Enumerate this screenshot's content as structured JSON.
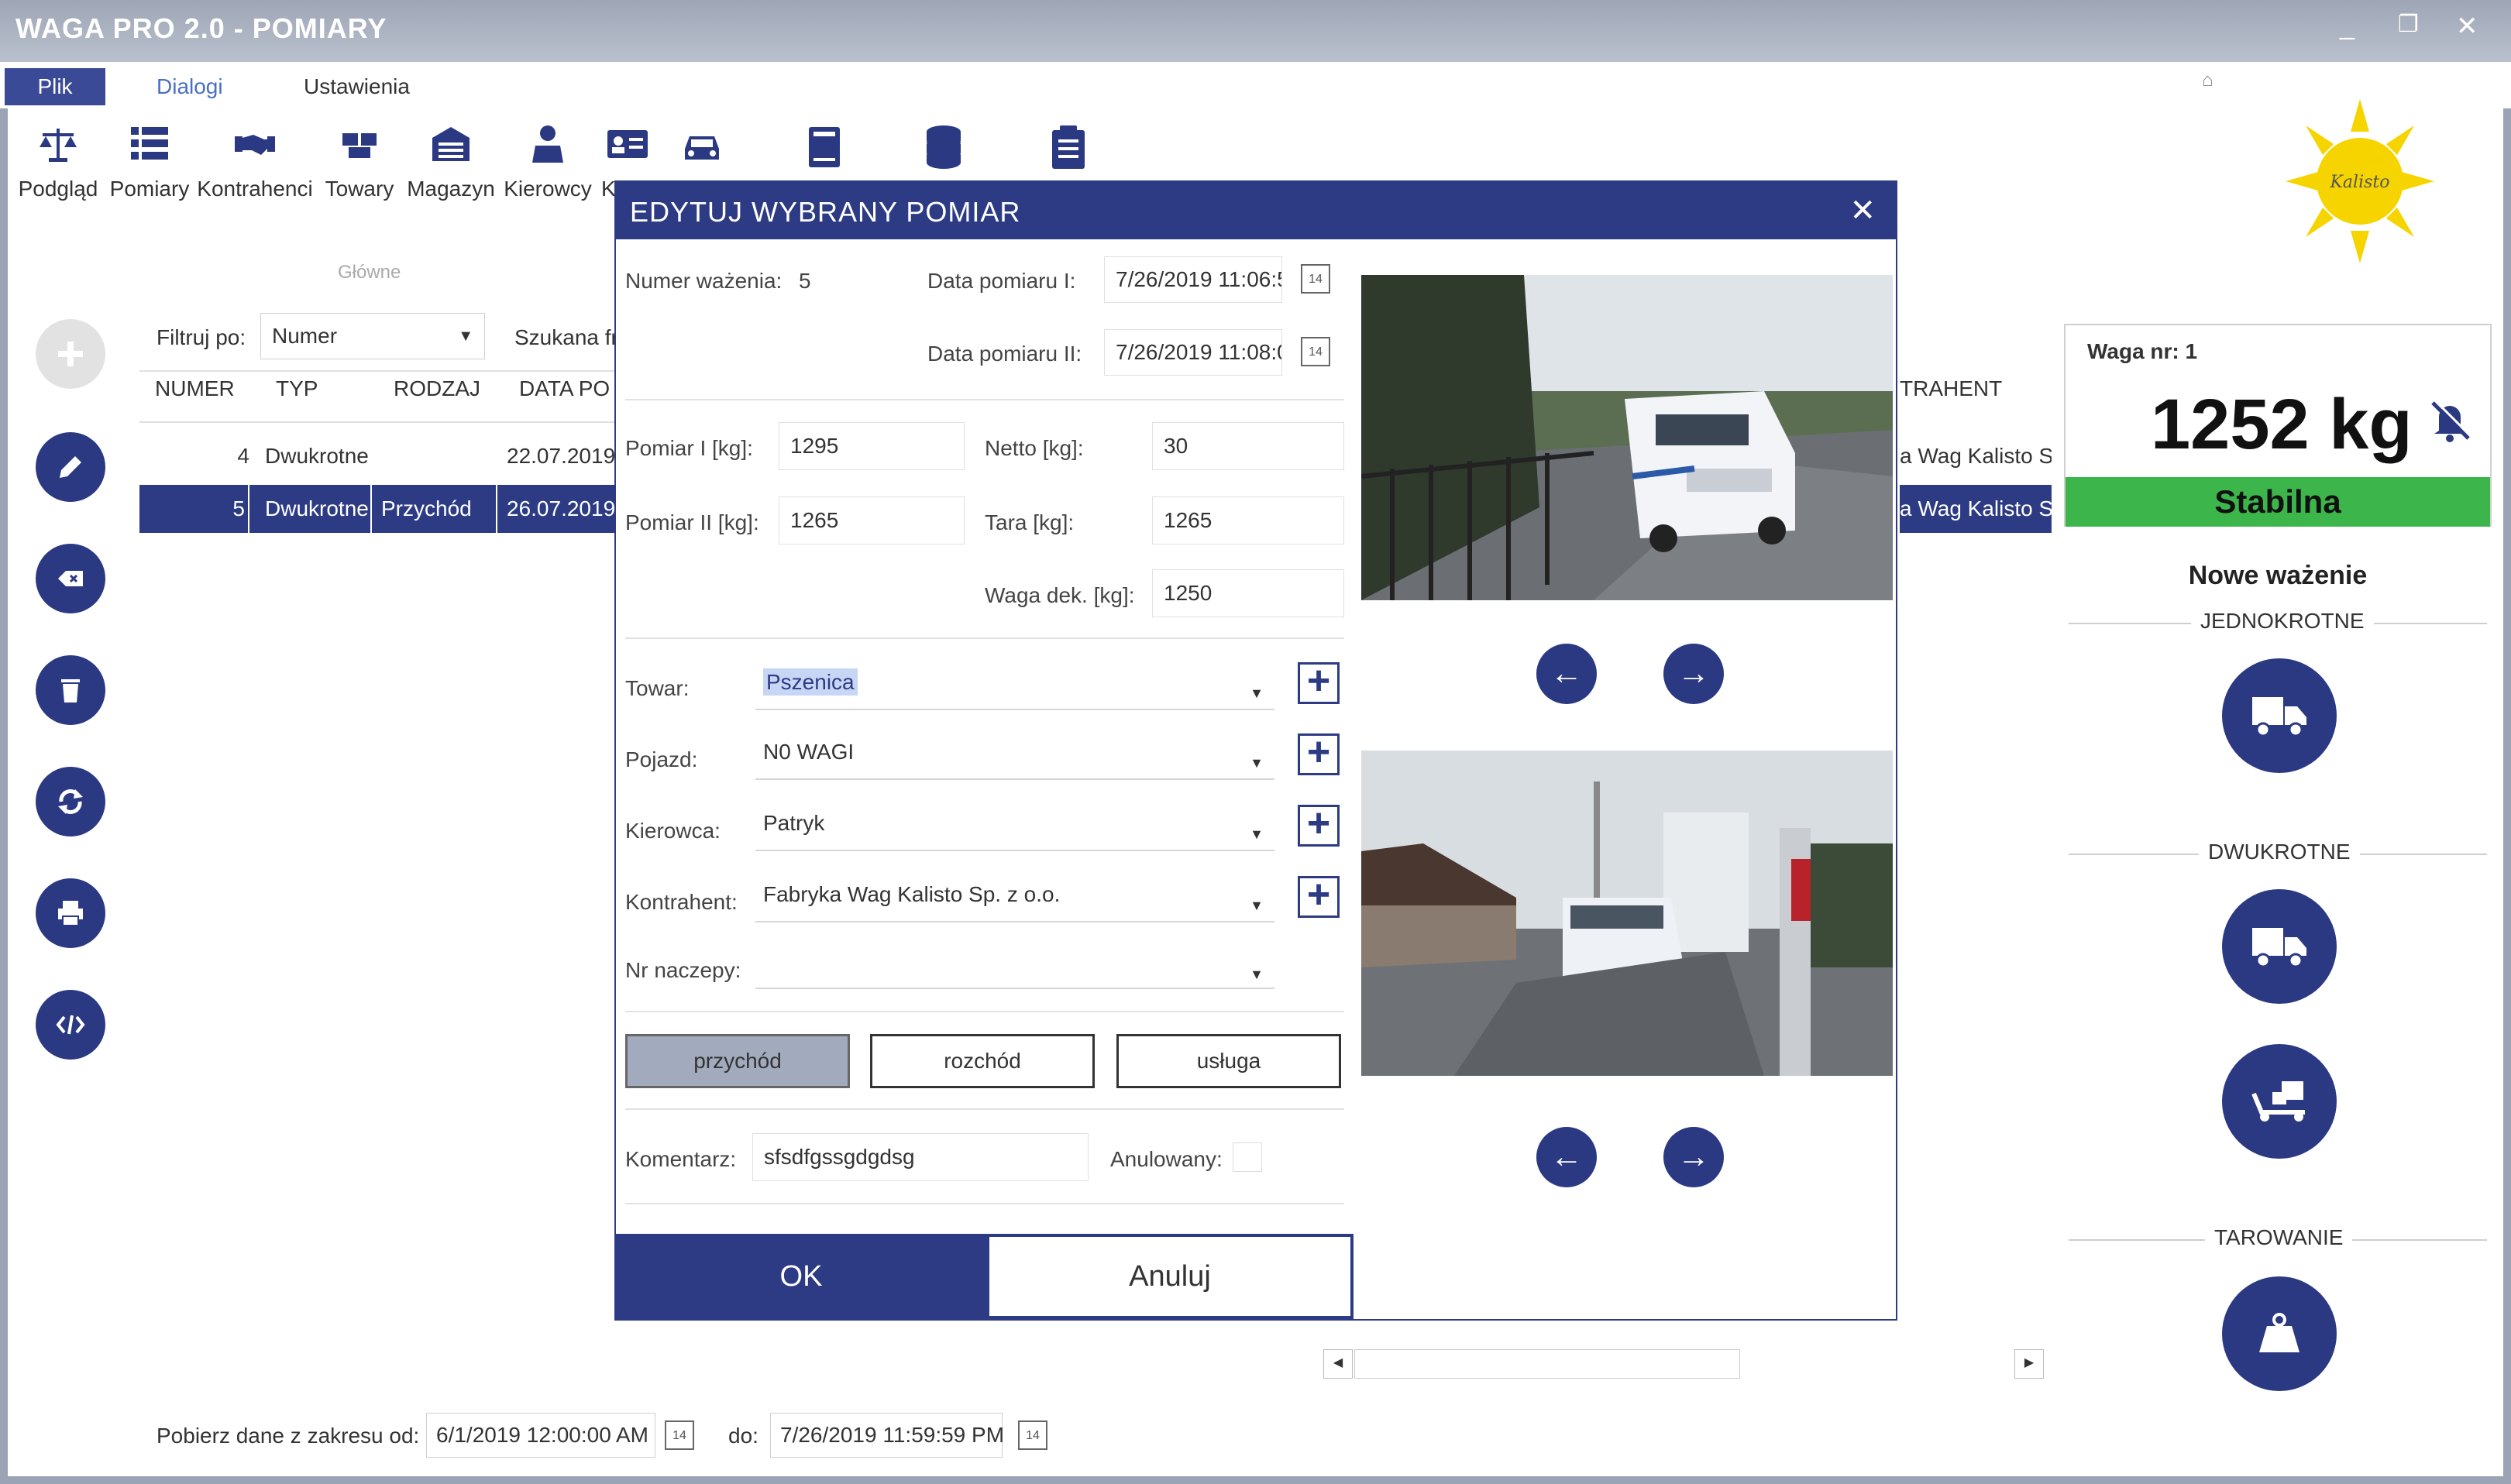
{
  "window": {
    "title": "WAGA PRO 2.0 - POMIARY",
    "minimize": "_",
    "restore": "❐",
    "close": "✕"
  },
  "menu": {
    "tabs": [
      "Plik",
      "Dialogi",
      "Ustawienia"
    ]
  },
  "ribbon": {
    "items": [
      {
        "label": "Podgląd",
        "icon": "scale-icon"
      },
      {
        "label": "Pomiary",
        "icon": "list-icon"
      },
      {
        "label": "Kontrahenci",
        "icon": "handshake-icon"
      },
      {
        "label": "Towary",
        "icon": "boxes-icon"
      },
      {
        "label": "Magazyn",
        "icon": "warehouse-icon"
      },
      {
        "label": "Kierowcy",
        "icon": "driver-icon"
      },
      {
        "label": "K",
        "icon": "id-card-icon"
      }
    ],
    "group_label": "Główne"
  },
  "logo": {
    "text": "Kalisto"
  },
  "filter": {
    "label": "Filtruj po:",
    "value": "Numer",
    "search_label": "Szukana fr"
  },
  "table": {
    "headers": [
      "NUMER",
      "TYP",
      "RODZAJ",
      "DATA PO",
      "TRAHENT"
    ],
    "rows": [
      {
        "numer": "4",
        "typ": "Dwukrotne",
        "rodzaj": "",
        "data": "22.07.2019",
        "kontrahent": "a Wag Kalisto S"
      },
      {
        "numer": "5",
        "typ": "Dwukrotne",
        "rodzaj": "Przychód",
        "data": "26.07.2019",
        "kontrahent": "a Wag Kalisto S"
      }
    ]
  },
  "dialog": {
    "title": "EDYTUJ WYBRANY POMIAR",
    "numer_label": "Numer ważenia:",
    "numer_value": "5",
    "data1_label": "Data pomiaru I:",
    "data1_value": "7/26/2019 11:06:5:",
    "data2_label": "Data pomiaru II:",
    "data2_value": "7/26/2019 11:08:0:",
    "pomiar1_label": "Pomiar I [kg]:",
    "pomiar1_value": "1295",
    "pomiar2_label": "Pomiar II [kg]:",
    "pomiar2_value": "1265",
    "netto_label": "Netto [kg]:",
    "netto_value": "30",
    "tara_label": "Tara [kg]:",
    "tara_value": "1265",
    "wagadek_label": "Waga dek. [kg]:",
    "wagadek_value": "1250",
    "towar_label": "Towar:",
    "towar_value": "Pszenica",
    "pojazd_label": "Pojazd:",
    "pojazd_value": "N0 WAGI",
    "kierowca_label": "Kierowca:",
    "kierowca_value": "Patryk",
    "kontrahent_label": "Kontrahent:",
    "kontrahent_value": "Fabryka Wag Kalisto Sp. z o.o.",
    "naczepa_label": "Nr naczepy:",
    "naczepa_value": "",
    "modes": [
      "przychód",
      "rozchód",
      "usługa"
    ],
    "active_mode": "przychód",
    "komentarz_label": "Komentarz:",
    "komentarz_value": "sfsdfgssgdgdsg",
    "anulowany_label": "Anulowany:",
    "ok": "OK",
    "cancel": "Anuluj"
  },
  "scale": {
    "title": "Waga nr: 1",
    "value": "1252 kg",
    "status": "Stabilna",
    "status_color": "#3cb54a"
  },
  "weighing": {
    "title": "Nowe ważenie",
    "sections": [
      "JEDNOKROTNE",
      "DWUKROTNE",
      "TAROWANIE"
    ]
  },
  "bottom": {
    "range_label": "Pobierz dane z zakresu od:",
    "from": "6/1/2019 12:00:00 AM",
    "to_label": "do:",
    "to": "7/26/2019 11:59:59 PM"
  },
  "accent_color": "#2d3b84"
}
